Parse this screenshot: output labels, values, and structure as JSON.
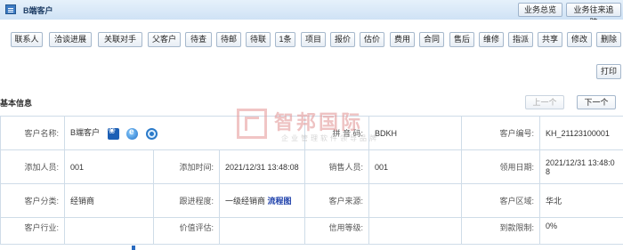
{
  "title_bar": {
    "title": "B端客户",
    "buttons": [
      "业务总览",
      "业务往来追踪"
    ]
  },
  "toolbar": {
    "buttons": [
      "联系人",
      "洽谈进展",
      "关联对手",
      "父客户",
      "待查",
      "待邮",
      "待联",
      "1条",
      "项目",
      "报价",
      "估价",
      "费用",
      "合同",
      "售后",
      "维修",
      "指派",
      "共享",
      "修改",
      "删除"
    ],
    "print_label": "打印"
  },
  "section": {
    "title": "基本信息",
    "prev_label": "上一个",
    "next_label": "下一个"
  },
  "watermark": {
    "main": "智邦国际",
    "sub": "企业管理软件领导品牌"
  },
  "info": {
    "row1": {
      "name_label": "客户名称:",
      "name_value": "B端客户",
      "pinyin_label": "拼 音 码:",
      "pinyin_value": "BDKH",
      "code_label": "客户编号:",
      "code_value": "KH_21123100001"
    },
    "row2": {
      "adder_label": "添加人员:",
      "adder_value": "001",
      "addtime_label": "添加时间:",
      "addtime_value": "2021/12/31 13:48:08",
      "sales_label": "销售人员:",
      "sales_value": "001",
      "claimdate_label": "领用日期:",
      "claimdate_value": "2021/12/31 13:48:08"
    },
    "row3": {
      "category_label": "客户分类:",
      "category_value": "经销商",
      "follow_label": "跟进程度:",
      "follow_value": "一级经销商",
      "follow_link": "流程图",
      "source_label": "客户来源:",
      "source_value": "",
      "region_label": "客户区域:",
      "region_value": "华北"
    },
    "row4": {
      "industry_label": "客户行业:",
      "industry_value": "",
      "value_label": "价值评估:",
      "value_value": "",
      "credit_label": "信用等级:",
      "credit_value": "",
      "limit_label": "到款限制:",
      "limit_value": "0%"
    }
  },
  "icons": [
    "paw-icon",
    "ie-icon",
    "search-engine-icon"
  ]
}
